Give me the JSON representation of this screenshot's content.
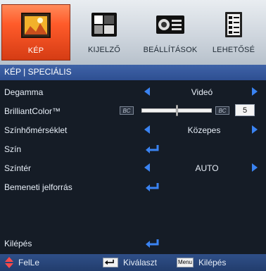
{
  "tabs": [
    {
      "label": "KÉP",
      "icon": "picture-icon",
      "active": true
    },
    {
      "label": "KIJELZŐ",
      "icon": "display-icon",
      "active": false
    },
    {
      "label": "BEÁLLÍTÁSOK",
      "icon": "projector-icon",
      "active": false
    },
    {
      "label": "LEHETŐSÉ",
      "icon": "options-icon",
      "active": false
    }
  ],
  "section": {
    "title": "KÉP | SPECIÁLIS"
  },
  "items": [
    {
      "label": "Degamma",
      "value": "Videó"
    },
    {
      "label": "BrilliantColor™",
      "value": "5",
      "slider_fraction": 0.5
    },
    {
      "label": "Színhőmérséklet",
      "value": "Közepes"
    },
    {
      "label": "Szín"
    },
    {
      "label": "Színtér",
      "value": "AUTO"
    },
    {
      "label": "Bemeneti jelforrás"
    },
    {
      "label": "Kilépés"
    }
  ],
  "footer": {
    "nav_label": "FelLe",
    "select_label": "Kiválaszt",
    "menu_key": "Menu",
    "exit_label": "Kilépés"
  },
  "colors": {
    "accent": "#ff5b2a",
    "arrow": "#3a83f2",
    "header": "#3f63a7",
    "background": "#151c26"
  }
}
